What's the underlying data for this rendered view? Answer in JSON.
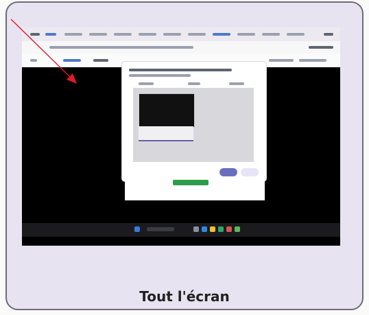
{
  "option": {
    "label": "Tout l'écran"
  },
  "dialog": {
    "share_label": "",
    "cancel_label": ""
  },
  "colors": {
    "card_background": "#e7e3f0",
    "card_border": "#6e6a78",
    "accent": "#6a6fbd",
    "arrow": "#e01a2a"
  },
  "icons": {
    "arrow": "pointer-arrow-icon"
  }
}
